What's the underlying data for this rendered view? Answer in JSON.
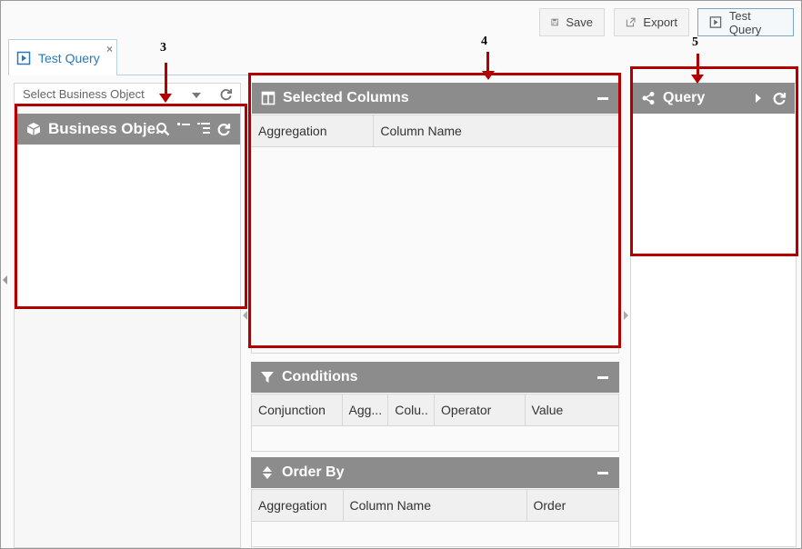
{
  "toolbar": {
    "save_label": "Save",
    "export_label": "Export",
    "test_query_label": "Test Query"
  },
  "tab": {
    "label": "Test Query",
    "close": "×"
  },
  "business_object_select": {
    "placeholder": "Select Business Object"
  },
  "business_object_panel": {
    "title": "Business Obje.."
  },
  "selected_columns": {
    "title": "Selected Columns",
    "columns": [
      "Aggregation",
      "Column Name"
    ]
  },
  "conditions": {
    "title": "Conditions",
    "columns": [
      "Conjunction",
      "Agg...",
      "Colu..",
      "Operator",
      "Value"
    ]
  },
  "order_by": {
    "title": "Order By",
    "columns": [
      "Aggregation",
      "Column Name",
      "Order"
    ]
  },
  "query_panel": {
    "title": "Query"
  },
  "annotations": {
    "m3": "3",
    "m4": "4",
    "m5": "5"
  },
  "colors": {
    "header_gray": "#8c8c8c",
    "annotation_red": "#b20000",
    "tab_blue": "#2a77b8"
  }
}
